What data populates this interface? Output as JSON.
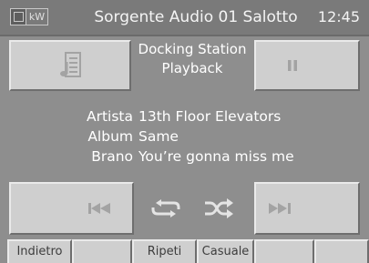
{
  "header": {
    "logo_text": "kW",
    "title": "Sorgente Audio 01 Salotto",
    "clock": "12:45"
  },
  "source": {
    "line1": "Docking Station",
    "line2": "Playback"
  },
  "track": {
    "artist_label": "Artista",
    "artist": "13th Floor Elevators",
    "album_label": "Album",
    "album": "Same",
    "song_label": "Brano",
    "song": "You’re gonna miss me"
  },
  "controls": {
    "icons": [
      "playlist-icon",
      "pause-icon",
      "previous-track-icon",
      "repeat-icon",
      "shuffle-icon",
      "next-track-icon"
    ]
  },
  "bottom_tabs": [
    "Indietro",
    "",
    "Ripeti",
    "Casuale",
    "",
    ""
  ],
  "colors": {
    "background": "#8e8e8e",
    "button_face": "#cfcfcf",
    "icon": "#a3a3a3"
  }
}
